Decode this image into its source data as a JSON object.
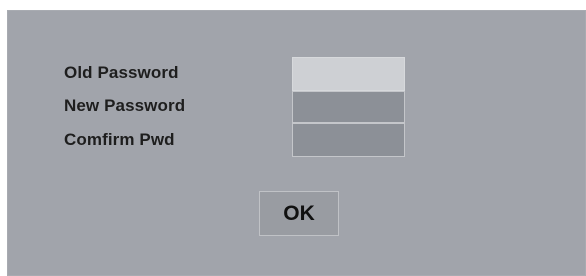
{
  "dialog": {
    "labels": {
      "old_password": "Old Password",
      "new_password": "New Password",
      "confirm_password": "Comfirm Pwd"
    },
    "fields": {
      "old_password": {
        "value": "",
        "placeholder": ""
      },
      "new_password": {
        "value": "",
        "placeholder": ""
      },
      "confirm_password": {
        "value": "",
        "placeholder": ""
      }
    },
    "ok_label": "OK"
  },
  "colors": {
    "dialog_background": "#a1a4ab",
    "focused_field": "#ced0d4",
    "field_background": "#8c9097",
    "button_background": "#999ca2"
  }
}
